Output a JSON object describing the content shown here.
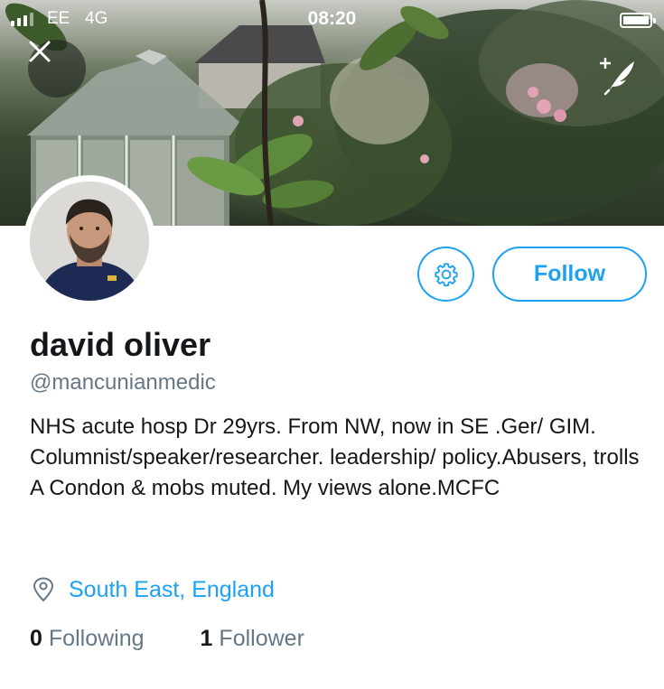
{
  "status_bar": {
    "carrier": "EE",
    "network": "4G",
    "time": "08:20"
  },
  "header": {
    "close_icon": "close-icon",
    "compose_icon": "compose-feather-icon"
  },
  "profile": {
    "name": "david oliver",
    "handle": "@mancunianmedic",
    "bio": "NHS acute hosp Dr 29yrs. From NW, now in SE .Ger/ GIM. Columnist/speaker/researcher. leadership/ policy.Abusers, trolls A Condon & mobs muted. My views alone.MCFC",
    "location": "South East, England",
    "following_count": "0",
    "following_label": "Following",
    "followers_count": "1",
    "followers_label": "Follower"
  },
  "actions": {
    "settings_icon": "gear-icon",
    "follow_label": "Follow"
  },
  "colors": {
    "accent": "#1da1f2",
    "secondary_text": "#657786",
    "primary_text": "#14171a"
  }
}
